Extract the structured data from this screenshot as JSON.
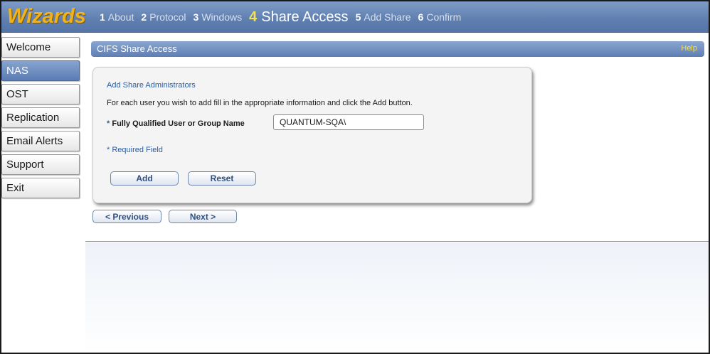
{
  "header": {
    "logo": "Wizards",
    "steps": [
      {
        "num": "1",
        "label": "About"
      },
      {
        "num": "2",
        "label": "Protocol"
      },
      {
        "num": "3",
        "label": "Windows"
      },
      {
        "num": "4",
        "label": "Share Access"
      },
      {
        "num": "5",
        "label": "Add Share"
      },
      {
        "num": "6",
        "label": "Confirm"
      }
    ],
    "active_step": "4"
  },
  "sidebar": {
    "items": [
      {
        "label": "Welcome"
      },
      {
        "label": "NAS"
      },
      {
        "label": "OST"
      },
      {
        "label": "Replication"
      },
      {
        "label": "Email Alerts"
      },
      {
        "label": "Support"
      },
      {
        "label": "Exit"
      }
    ],
    "active": "NAS"
  },
  "main": {
    "title": "CIFS Share Access",
    "help_label": "Help",
    "panel": {
      "heading": "Add Share Administrators",
      "description": "For each user you wish to add fill in the appropriate information and click the Add button.",
      "field_label_star": "*",
      "field_label": "Fully Qualified User or Group Name",
      "field_value": "QUANTUM-SQA\\",
      "required_note": "* Required Field",
      "add_label": "Add",
      "reset_label": "Reset"
    },
    "previous_label": "< Previous",
    "next_label": "Next >"
  },
  "colors": {
    "header_blue": "#5f7fb0",
    "logo_gold": "#f2b21a",
    "active_step_yellow": "#f2e25a",
    "link_blue": "#2f5d9e"
  }
}
